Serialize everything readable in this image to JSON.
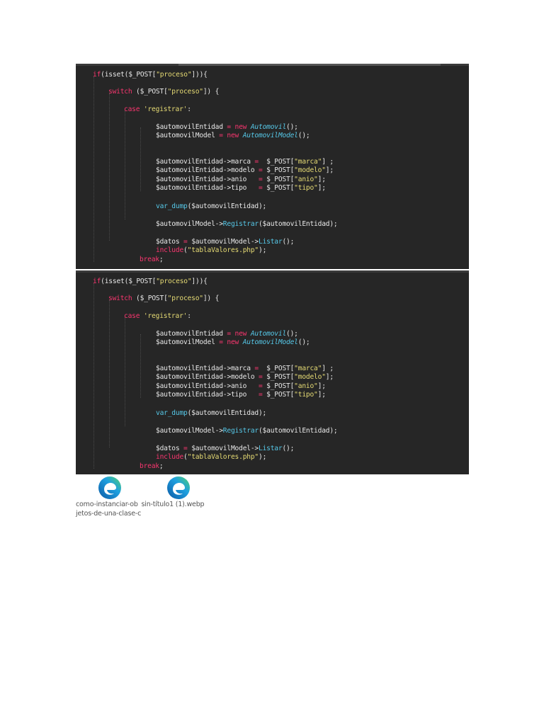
{
  "code_screenshots": [
    {
      "lines": [
        [
          [
            "kw",
            "if"
          ],
          [
            "v",
            "("
          ],
          [
            "fn2",
            "isset"
          ],
          [
            "v",
            "($_POST["
          ],
          [
            "str",
            "\"proceso\""
          ],
          [
            "v",
            "])){"
          ]
        ],
        [
          [
            "kw",
            "switch"
          ],
          [
            "v",
            " ($_POST["
          ],
          [
            "str",
            "\"proceso\""
          ],
          [
            "v",
            "]) {"
          ]
        ],
        [
          [
            "kw",
            "case"
          ],
          [
            "v",
            " "
          ],
          [
            "str",
            "'registrar'"
          ],
          [
            "v",
            ":"
          ]
        ],
        [
          [
            "v",
            "$automovilEntidad "
          ],
          [
            "kw",
            "="
          ],
          [
            "v",
            " "
          ],
          [
            "kw",
            "new"
          ],
          [
            "v",
            " "
          ],
          [
            "cls",
            "Automovil"
          ],
          [
            "v",
            "();"
          ]
        ],
        [
          [
            "v",
            "$automovilModel "
          ],
          [
            "kw",
            "="
          ],
          [
            "v",
            " "
          ],
          [
            "kw",
            "new"
          ],
          [
            "v",
            " "
          ],
          [
            "cls",
            "AutomovilModel"
          ],
          [
            "v",
            "();"
          ]
        ],
        [
          [
            "v",
            "$automovilEntidad->marca "
          ],
          [
            "kw",
            "="
          ],
          [
            "v",
            "  $_POST["
          ],
          [
            "str",
            "\"marca\""
          ],
          [
            "v",
            "] ;"
          ]
        ],
        [
          [
            "v",
            "$automovilEntidad->modelo "
          ],
          [
            "kw",
            "="
          ],
          [
            "v",
            " $_POST["
          ],
          [
            "str",
            "\"modelo\""
          ],
          [
            "v",
            "];"
          ]
        ],
        [
          [
            "v",
            "$automovilEntidad->anio   "
          ],
          [
            "kw",
            "="
          ],
          [
            "v",
            " $_POST["
          ],
          [
            "str",
            "\"anio\""
          ],
          [
            "v",
            "];"
          ]
        ],
        [
          [
            "v",
            "$automovilEntidad->tipo   "
          ],
          [
            "kw",
            "="
          ],
          [
            "v",
            " $_POST["
          ],
          [
            "str",
            "\"tipo\""
          ],
          [
            "v",
            "];"
          ]
        ],
        [
          [
            "fn",
            "var_dump"
          ],
          [
            "v",
            "($automovilEntidad);"
          ]
        ],
        [
          [
            "v",
            "$automovilModel->"
          ],
          [
            "fn",
            "Registrar"
          ],
          [
            "v",
            "($automovilEntidad);"
          ]
        ],
        [
          [
            "v",
            "$datos "
          ],
          [
            "kw",
            "="
          ],
          [
            "v",
            " $automovilModel->"
          ],
          [
            "fn",
            "Listar"
          ],
          [
            "v",
            "();"
          ]
        ],
        [
          [
            "kw",
            "include"
          ],
          [
            "v",
            "("
          ],
          [
            "str",
            "\"tablaValores.php\""
          ],
          [
            "v",
            ");"
          ]
        ],
        [
          [
            "kw",
            "break"
          ],
          [
            "v",
            ";"
          ]
        ]
      ]
    },
    {
      "lines": [
        [
          [
            "kw",
            "if"
          ],
          [
            "v",
            "("
          ],
          [
            "fn2",
            "isset"
          ],
          [
            "v",
            "($_POST["
          ],
          [
            "str",
            "\"proceso\""
          ],
          [
            "v",
            "])){"
          ]
        ],
        [
          [
            "kw",
            "switch"
          ],
          [
            "v",
            " ($_POST["
          ],
          [
            "str",
            "\"proceso\""
          ],
          [
            "v",
            "]) {"
          ]
        ],
        [
          [
            "kw",
            "case"
          ],
          [
            "v",
            " "
          ],
          [
            "str",
            "'registrar'"
          ],
          [
            "v",
            ":"
          ]
        ],
        [
          [
            "v",
            "$automovilEntidad "
          ],
          [
            "kw",
            "="
          ],
          [
            "v",
            " "
          ],
          [
            "kw",
            "new"
          ],
          [
            "v",
            " "
          ],
          [
            "cls",
            "Automovil"
          ],
          [
            "v",
            "();"
          ]
        ],
        [
          [
            "v",
            "$automovilModel "
          ],
          [
            "kw",
            "="
          ],
          [
            "v",
            " "
          ],
          [
            "kw",
            "new"
          ],
          [
            "v",
            " "
          ],
          [
            "cls",
            "AutomovilModel"
          ],
          [
            "v",
            "();"
          ]
        ],
        [
          [
            "v",
            "$automovilEntidad->marca "
          ],
          [
            "kw",
            "="
          ],
          [
            "v",
            "  $_POST["
          ],
          [
            "str",
            "\"marca\""
          ],
          [
            "v",
            "] ;"
          ]
        ],
        [
          [
            "v",
            "$automovilEntidad->modelo "
          ],
          [
            "kw",
            "="
          ],
          [
            "v",
            " $_POST["
          ],
          [
            "str",
            "\"modelo\""
          ],
          [
            "v",
            "];"
          ]
        ],
        [
          [
            "v",
            "$automovilEntidad->anio   "
          ],
          [
            "kw",
            "="
          ],
          [
            "v",
            " $_POST["
          ],
          [
            "str",
            "\"anio\""
          ],
          [
            "v",
            "];"
          ]
        ],
        [
          [
            "v",
            "$automovilEntidad->tipo   "
          ],
          [
            "kw",
            "="
          ],
          [
            "v",
            " $_POST["
          ],
          [
            "str",
            "\"tipo\""
          ],
          [
            "v",
            "];"
          ]
        ],
        [
          [
            "fn",
            "var_dump"
          ],
          [
            "v",
            "($automovilEntidad);"
          ]
        ],
        [
          [
            "v",
            "$automovilModel->"
          ],
          [
            "fn",
            "Registrar"
          ],
          [
            "v",
            "($automovilEntidad);"
          ]
        ],
        [
          [
            "v",
            "$datos "
          ],
          [
            "kw",
            "="
          ],
          [
            "v",
            " $automovilModel->"
          ],
          [
            "fn",
            "Listar"
          ],
          [
            "v",
            "();"
          ]
        ],
        [
          [
            "kw",
            "include"
          ],
          [
            "v",
            "("
          ],
          [
            "str",
            "\"tablaValores.php\""
          ],
          [
            "v",
            ");"
          ]
        ],
        [
          [
            "kw",
            "break"
          ],
          [
            "v",
            ";"
          ]
        ]
      ]
    }
  ],
  "attachments": [
    {
      "icon": "edge-icon",
      "name_line1": "como-instanciar-ob",
      "name_line2": "jetos-de-una-clase-c"
    },
    {
      "icon": "edge-icon",
      "name_line1": "sin-título1 (1).webp"
    }
  ],
  "colors": {
    "keyword": "#f9366f",
    "string": "#e6db74",
    "class": "#56c8e8",
    "background": "#262626"
  }
}
